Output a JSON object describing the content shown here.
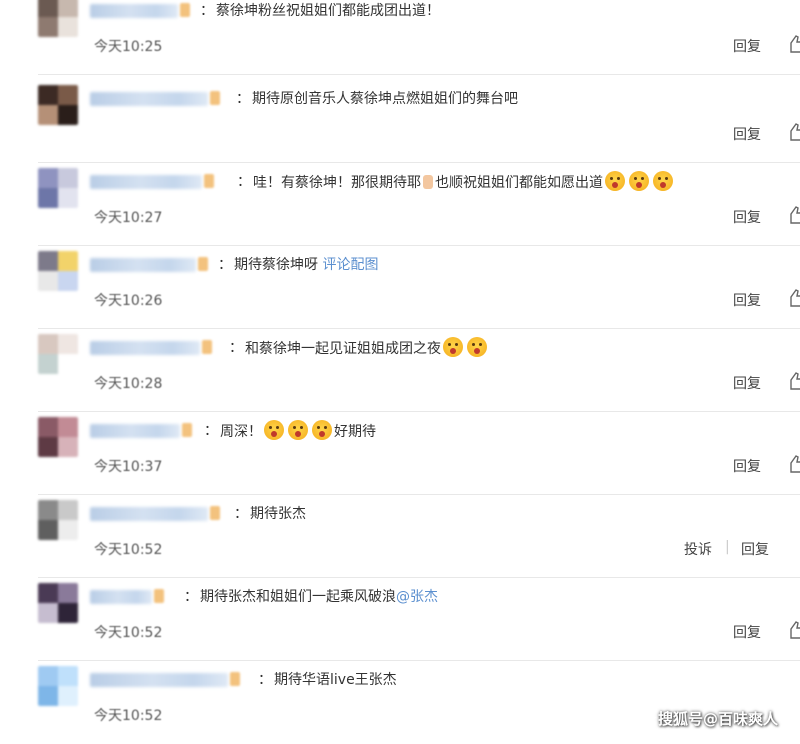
{
  "comments": [
    {
      "time": "今天10:25",
      "colon": "：",
      "parts": [
        {
          "t": "text",
          "v": "蔡徐坤粉丝祝姐姐们都能成团出道！"
        }
      ],
      "reply": "回复"
    },
    {
      "time": "",
      "colon": "：",
      "parts": [
        {
          "t": "text",
          "v": "期待原创音乐人蔡徐坤点燃姐姐们的舞台吧"
        }
      ],
      "reply": "回复"
    },
    {
      "time": "今天10:27",
      "colon": "：",
      "parts": [
        {
          "t": "text",
          "v": "哇！有蔡徐坤！那很期待耶"
        },
        {
          "t": "hand"
        },
        {
          "t": "text",
          "v": "也顺祝姐姐们都能如愿出道"
        },
        {
          "t": "emoji"
        },
        {
          "t": "emoji"
        },
        {
          "t": "emoji"
        }
      ],
      "reply": "回复"
    },
    {
      "time": "今天10:26",
      "colon": "：",
      "parts": [
        {
          "t": "text",
          "v": "期待蔡徐坤呀 "
        },
        {
          "t": "link",
          "v": "评论配图"
        }
      ],
      "reply": "回复"
    },
    {
      "time": "今天10:28",
      "colon": "：",
      "parts": [
        {
          "t": "text",
          "v": "和蔡徐坤一起见证姐姐成团之夜"
        },
        {
          "t": "emoji"
        },
        {
          "t": "emoji"
        }
      ],
      "reply": "回复"
    },
    {
      "time": "今天10:37",
      "colon": "：",
      "parts": [
        {
          "t": "text",
          "v": "周深！"
        },
        {
          "t": "emoji"
        },
        {
          "t": "emoji"
        },
        {
          "t": "emoji"
        },
        {
          "t": "text",
          "v": "好期待"
        }
      ],
      "reply": "回复"
    },
    {
      "time": "今天10:52",
      "colon": "：",
      "parts": [
        {
          "t": "text",
          "v": "期待张杰"
        }
      ],
      "report": "投诉",
      "separator": "|",
      "reply": "回复"
    },
    {
      "time": "今天10:52",
      "colon": "：",
      "parts": [
        {
          "t": "text",
          "v": "期待张杰和姐姐们一起乘风破浪"
        },
        {
          "t": "link",
          "v": "@张杰"
        }
      ],
      "reply": "回复"
    },
    {
      "time": "今天10:52",
      "colon": "：",
      "parts": [
        {
          "t": "text",
          "v": "期待华语live王张杰"
        }
      ]
    }
  ],
  "watermark": "搜狐号@百味爽人",
  "colors": {
    "link": "#5b8fcf",
    "text": "#333333",
    "divider": "#e8e8e8"
  },
  "icons": {
    "like": "thumbs-up-icon",
    "emoji": "crying-emoji-icon",
    "hand": "ok-hand-icon"
  }
}
